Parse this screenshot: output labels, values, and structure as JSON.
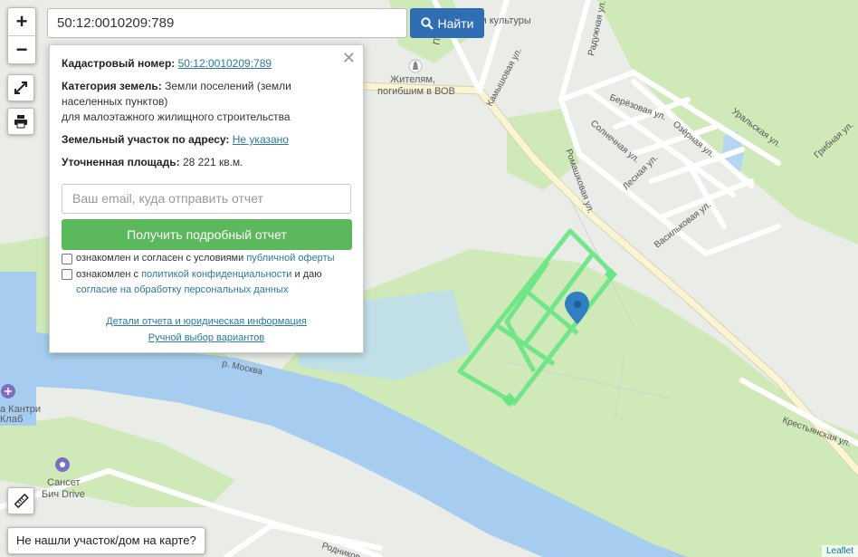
{
  "map": {
    "streets": [
      "Радужная ул.",
      "Камышовая ул.",
      "Берёзовая ул.",
      "Солнечная ул.",
      "Озёрная ул.",
      "Уральская ул.",
      "Грибная ул.",
      "Лесная ул.",
      "Ромашковая ул.",
      "Васильковая ул.",
      "Крестьянская ул.",
      "р. Москва",
      "Родников",
      "Пе"
    ],
    "pois": {
      "culture_house": "ом культуры",
      "monument_line1": "Жителям,",
      "monument_line2": "погибшим в ВОВ",
      "club_line1": "а Кантри",
      "club_line2": "Клаб",
      "sunset_line1": "Сансет",
      "sunset_line2": "Бич Drive"
    },
    "colors": {
      "land": "#e9ece7",
      "forest": "#cfeab8",
      "water": "#b5d5f0",
      "river": "#a6cdef",
      "road": "#ffffff",
      "road_main": "#fbf5d4",
      "plot": "#69e584",
      "marker": "#2f7fc1"
    }
  },
  "controls": {
    "zoom_in": "+",
    "zoom_out": "−",
    "expand_icon": "expand-icon",
    "print_icon": "print-icon",
    "ruler_icon": "ruler-icon"
  },
  "search": {
    "value": "50:12:0010209:789",
    "button_label": "Найти"
  },
  "popup": {
    "close": "✕",
    "cadastral_label": "Кадастровый номер:",
    "cadastral_value": "50:12:0010209:789",
    "category_label": "Категория земель:",
    "category_value_line1": "Земли поселений (земли",
    "category_value_line2": "населенных пунктов)",
    "category_value_line3": "для малоэтажного жилищного строительства",
    "address_label": "Земельный участок по адресу:",
    "address_value": "Не указано",
    "area_label": "Уточненная площадь:",
    "area_value": "28 221 кв.м.",
    "email_placeholder": "Ваш email, куда отправить отчет",
    "report_button": "Получить подробный отчет",
    "agree1_text": "ознакомлен и согласен с условиями",
    "agree1_link": "публичной оферты",
    "agree2_text_a": "ознакомлен с",
    "agree2_link1": "политикой конфиденциальности",
    "agree2_text_b": "и даю",
    "agree2_link2": "согласие на обработку персональных данных",
    "details_link": "Детали отчета и юридическая информация",
    "manual_link": "Ручной выбор вариантов"
  },
  "not_found_button": "Не нашли участок/дом на карте?",
  "attribution": "Leaflet"
}
